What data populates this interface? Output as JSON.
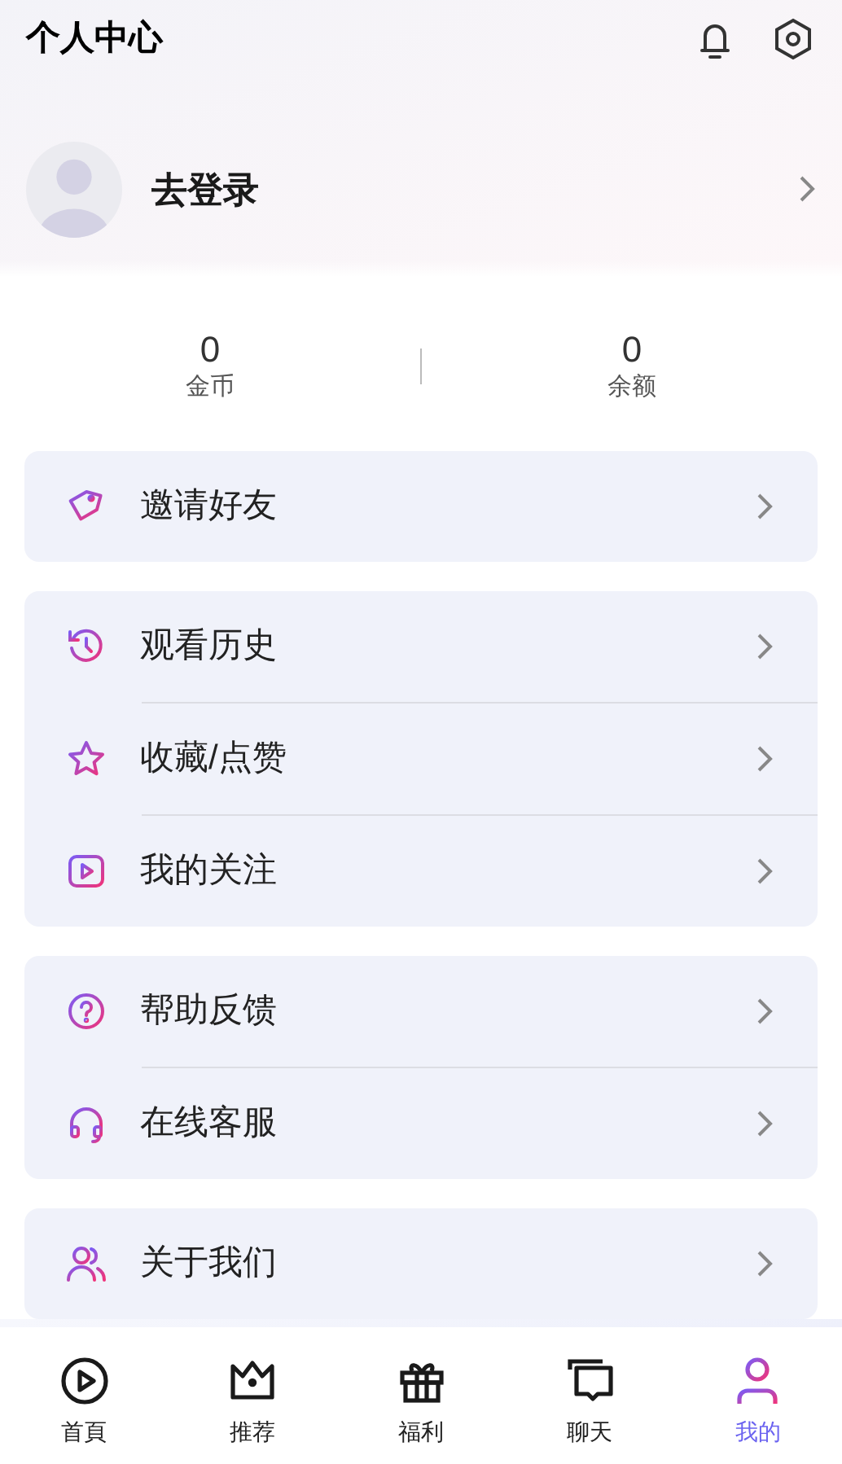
{
  "header": {
    "title": "个人中心"
  },
  "profile": {
    "name": "去登录"
  },
  "stats": [
    {
      "value": "0",
      "label": "金币"
    },
    {
      "value": "0",
      "label": "余额"
    }
  ],
  "menu_groups": [
    {
      "items": [
        {
          "kind": "tag",
          "label": "邀请好友"
        }
      ]
    },
    {
      "items": [
        {
          "kind": "history",
          "label": "观看历史"
        },
        {
          "kind": "star",
          "label": "收藏/点赞"
        },
        {
          "kind": "play",
          "label": "我的关注"
        }
      ]
    },
    {
      "items": [
        {
          "kind": "help",
          "label": "帮助反馈"
        },
        {
          "kind": "headset",
          "label": "在线客服"
        }
      ]
    },
    {
      "items": [
        {
          "kind": "users",
          "label": "关于我们"
        }
      ]
    }
  ],
  "tab_bar": [
    {
      "kind": "play",
      "label": "首頁",
      "selected": false
    },
    {
      "kind": "crown",
      "label": "推荐",
      "selected": false
    },
    {
      "kind": "gift",
      "label": "福利",
      "selected": false
    },
    {
      "kind": "chat",
      "label": "聊天",
      "selected": false
    },
    {
      "kind": "user",
      "label": "我的",
      "selected": true
    }
  ]
}
